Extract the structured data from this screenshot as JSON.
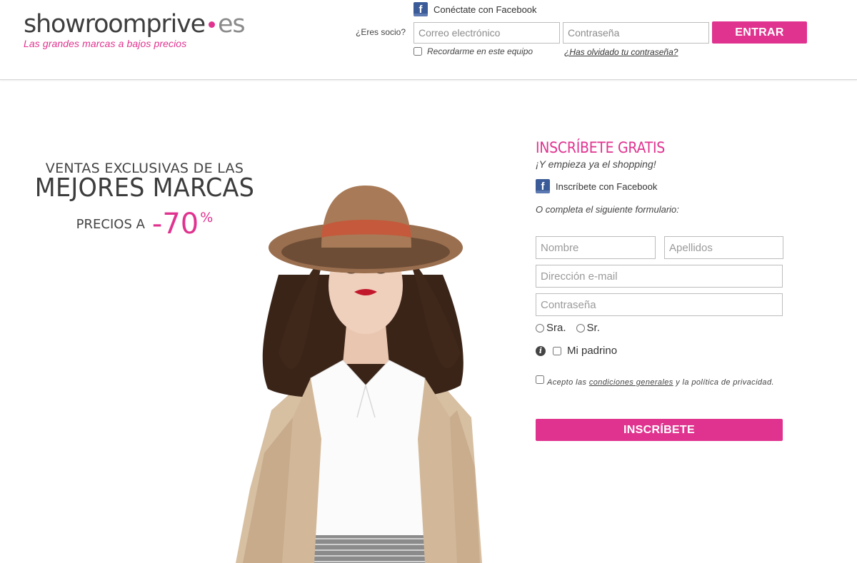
{
  "header": {
    "logo": {
      "brand": "showroomprive",
      "suffix": "es",
      "tagline": "Las grandes marcas a bajos precios"
    },
    "facebook_connect": {
      "icon": "facebook-icon",
      "label": "Conéctate con Facebook"
    },
    "member_label": "¿Eres socio?",
    "email_placeholder": "Correo electrónico",
    "password_placeholder": "Contraseña",
    "login_button": "ENTRAR",
    "remember_label": "Recordarme en este equipo",
    "forgot_link": "¿Has olvidado tu contraseña?"
  },
  "hero": {
    "line1": "VENTAS EXCLUSIVAS DE LAS",
    "line2": "MEJORES MARCAS",
    "precios": "PRECIOS A",
    "discount": "-70",
    "percent": "%"
  },
  "signup": {
    "title": "INSCRÍBETE GRATIS",
    "subtitle": "¡Y empieza ya el shopping!",
    "facebook": {
      "icon": "facebook-icon",
      "label": "Inscríbete con Facebook"
    },
    "or_text": "O completa el siguiente formulario:",
    "first_name_placeholder": "Nombre",
    "last_name_placeholder": "Apellidos",
    "email_placeholder": "Dirección e-mail",
    "password_placeholder": "Contraseña",
    "gender_options": [
      "Sra.",
      "Sr."
    ],
    "padrino_label": "Mi padrino",
    "terms_prefix": "Acepto las ",
    "terms_link": "condiciones generales",
    "terms_suffix": " y la política de privacidad.",
    "submit_button": "INSCRÍBETE"
  },
  "colors": {
    "accent": "#e0338f",
    "facebook": "#3b5b98",
    "text": "#333333"
  }
}
